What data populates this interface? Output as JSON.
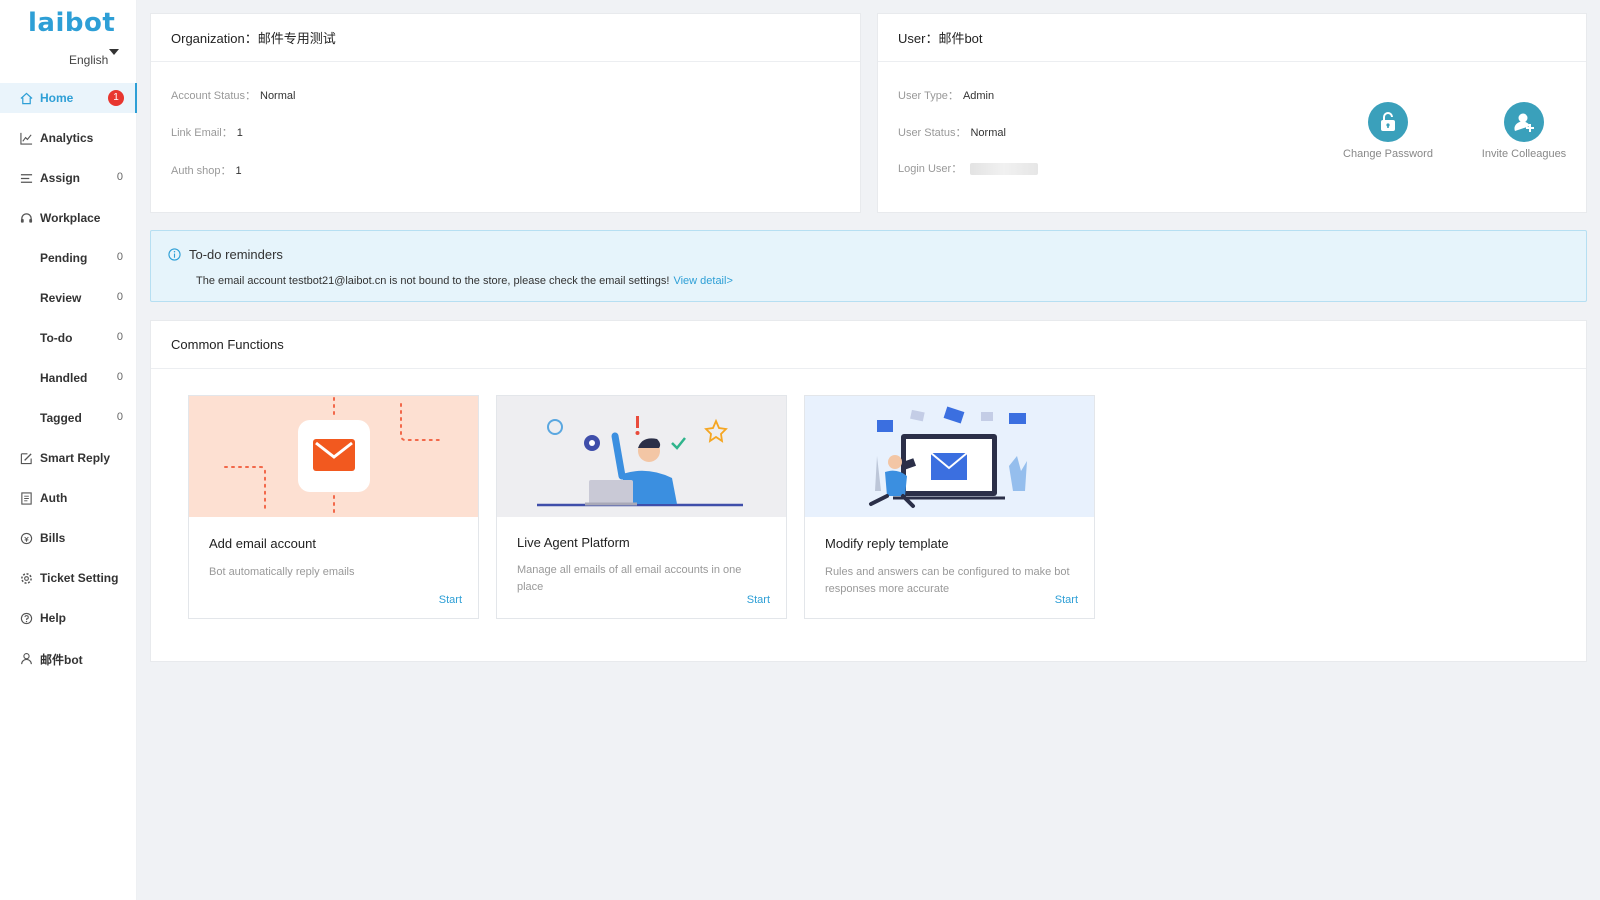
{
  "app": {
    "logo": "laibot",
    "language": "English"
  },
  "sidebar": {
    "items": [
      {
        "label": "Home",
        "badge": "1"
      },
      {
        "label": "Analytics"
      },
      {
        "label": "Assign",
        "count": "0"
      },
      {
        "label": "Workplace"
      },
      {
        "label": "Pending",
        "count": "0"
      },
      {
        "label": "Review",
        "count": "0"
      },
      {
        "label": "To-do",
        "count": "0"
      },
      {
        "label": "Handled",
        "count": "0"
      },
      {
        "label": "Tagged",
        "count": "0"
      },
      {
        "label": "Smart Reply"
      },
      {
        "label": "Auth"
      },
      {
        "label": "Bills"
      },
      {
        "label": "Ticket Setting"
      },
      {
        "label": "Help"
      },
      {
        "label": "邮件bot"
      }
    ]
  },
  "org": {
    "title": "Organization：邮件专用测试",
    "account_status_label": "Account Status：",
    "account_status": "Normal",
    "link_email_label": "Link Email：",
    "link_email": "1",
    "auth_shop_label": "Auth shop：",
    "auth_shop": "1"
  },
  "user": {
    "title": "User：邮件bot",
    "user_type_label": "User Type：",
    "user_type": "Admin",
    "user_status_label": "User Status：",
    "user_status": "Normal",
    "login_user_label": "Login User：",
    "change_password": "Change Password",
    "invite_colleagues": "Invite Colleagues"
  },
  "reminder": {
    "title": "To-do reminders",
    "message": "The email account testbot21@laibot.cn is not bound to the store, please check the email settings!",
    "link": "View detail>"
  },
  "functions": {
    "title": "Common Functions",
    "cards": [
      {
        "title": "Add email account",
        "desc": "Bot automatically reply emails",
        "start": "Start"
      },
      {
        "title": "Live Agent Platform",
        "desc": "Manage all emails of all email accounts in one place",
        "start": "Start"
      },
      {
        "title": "Modify reply template",
        "desc": "Rules and answers can be configured to make bot responses more accurate",
        "start": "Start"
      }
    ]
  },
  "colors": {
    "accent": "#2e9fd6",
    "badge": "#e8362f",
    "action": "#3aa0bb"
  }
}
